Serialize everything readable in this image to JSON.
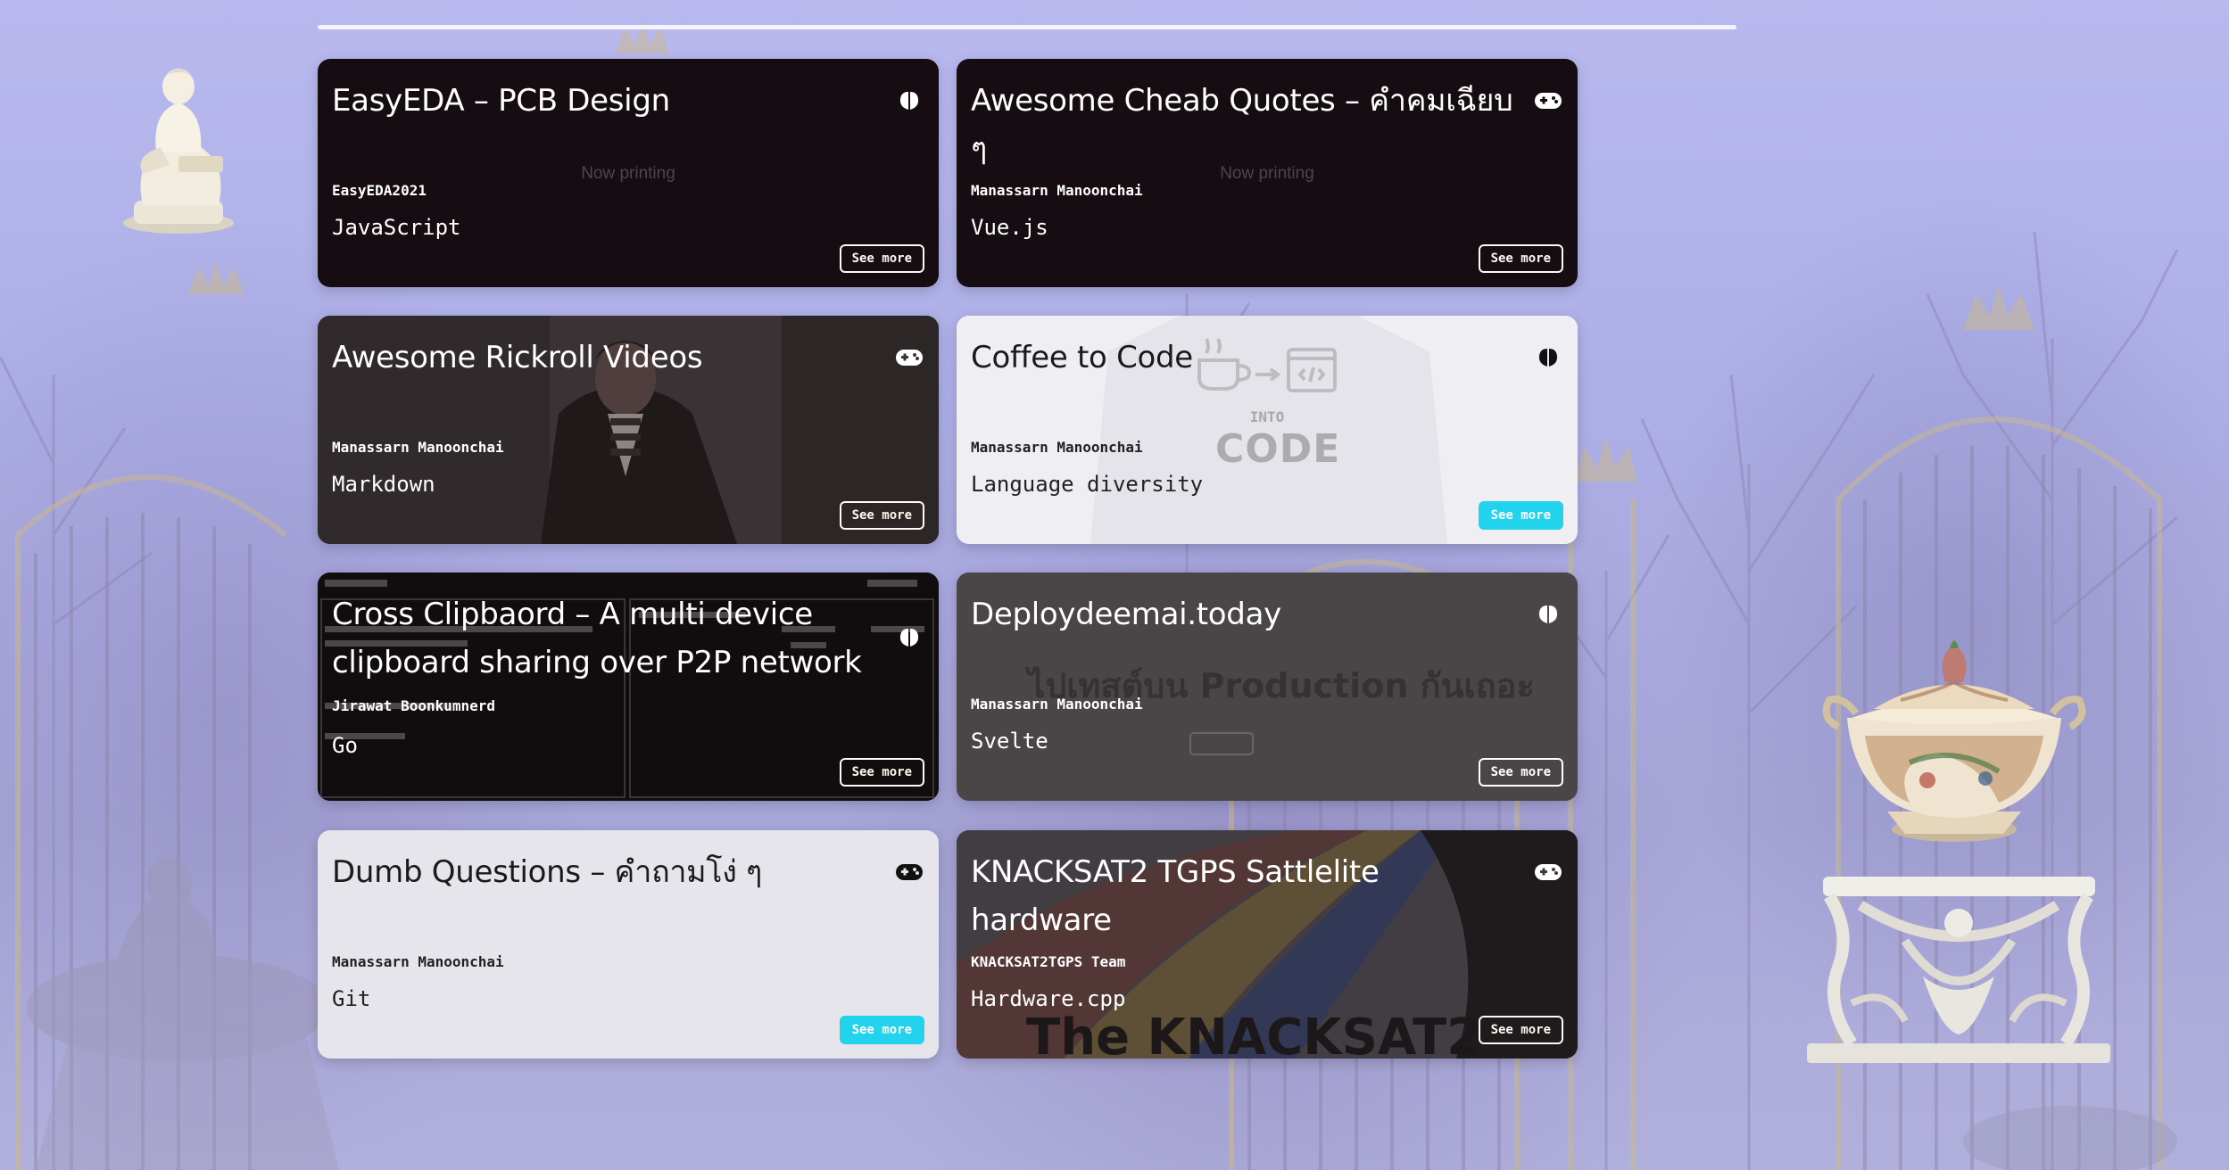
{
  "progress_line": {
    "fraction": 1.0
  },
  "cards": [
    {
      "title": "EasyEDA – PCB Design",
      "icon": "brain-icon",
      "overlay": "Now printing",
      "author": "EasyEDA2021",
      "language": "JavaScript",
      "button": "See more",
      "theme": "dark"
    },
    {
      "title": "Awesome Cheab Quotes – คำคมเฉียบ ๆ",
      "icon": "gamepad-icon",
      "overlay": "Now printing",
      "author": "Manassarn Manoonchai",
      "language": "Vue.js",
      "button": "See more",
      "theme": "dark"
    },
    {
      "title": "Awesome Rickroll Videos",
      "icon": "gamepad-icon",
      "author": "Manassarn Manoonchai",
      "language": "Markdown",
      "button": "See more",
      "theme": "rickroll"
    },
    {
      "title": "Coffee to Code",
      "icon": "brain-icon",
      "art_text": {
        "into": "INTO",
        "code": "CODE"
      },
      "author": "Manassarn Manoonchai",
      "language": "Language diversity",
      "button": "See more",
      "theme": "light"
    },
    {
      "title": "Cross Clipbaord – A multi device clipboard sharing over P2P network",
      "icon": "brain-icon",
      "author": "Jirawat Boonkumnerd",
      "language": "Go",
      "button": "See more",
      "theme": "terminal"
    },
    {
      "title": "Deploydeemai.today",
      "icon": "brain-icon",
      "art_text": {
        "headline": "ไปเทสต์บน Production กันเถอะ"
      },
      "author": "Manassarn Manoonchai",
      "language": "Svelte",
      "button": "See more",
      "theme": "grey"
    },
    {
      "title": "Dumb Questions – คำถามโง่ ๆ",
      "icon": "gamepad-icon",
      "author": "Manassarn Manoonchai",
      "language": "Git",
      "button": "See more",
      "theme": "light"
    },
    {
      "title": "KNACKSAT2 TGPS Sattlelite hardware",
      "icon": "gamepad-icon",
      "art_text": {
        "banner": "The KNACKSAT2"
      },
      "author": "KNACKSAT2TGPS Team",
      "language": "Hardware.cpp",
      "button": "See more",
      "theme": "knacksat"
    }
  ]
}
